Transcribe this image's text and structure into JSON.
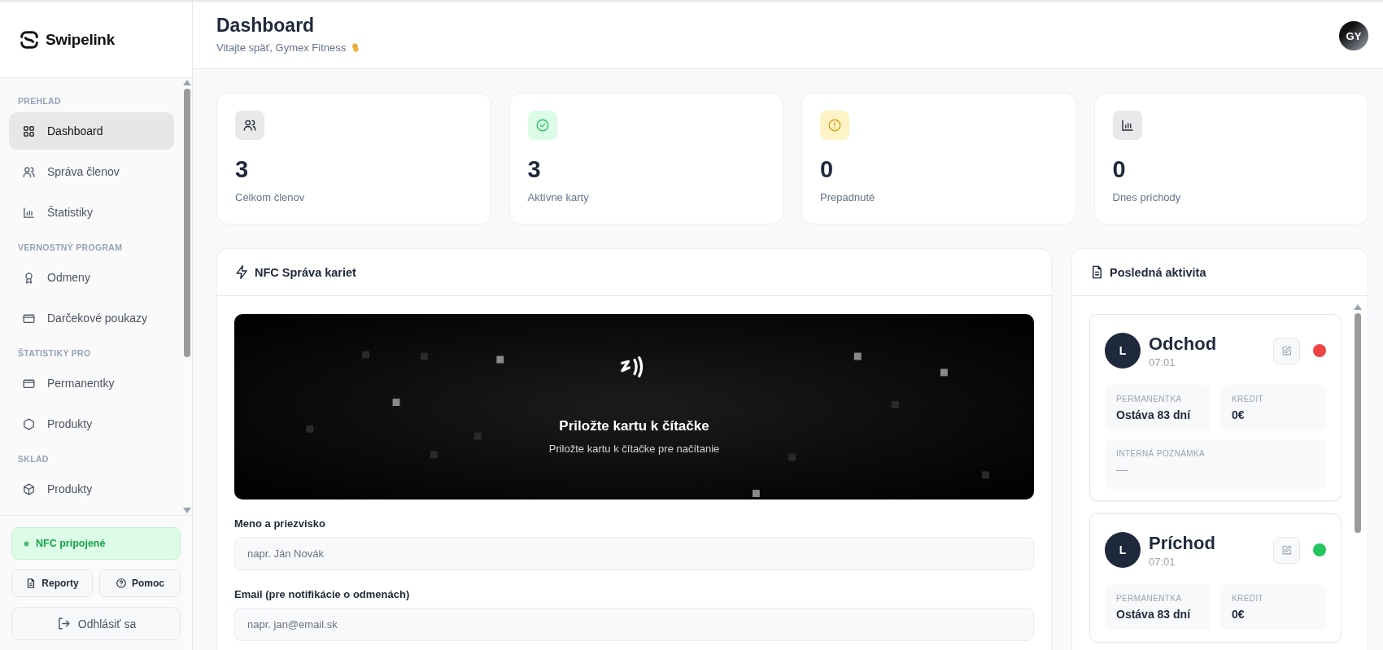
{
  "sidebar": {
    "logo": "Swipelink",
    "sections": [
      {
        "heading": "PREHĽAD",
        "items": [
          {
            "label": "Dashboard",
            "selected": true
          },
          {
            "label": "Správa členov",
            "selected": false
          },
          {
            "label": "Štatistiky",
            "selected": false
          }
        ]
      },
      {
        "heading": "VERNOSTNÝ PROGRAM",
        "items": [
          {
            "label": "Odmeny",
            "selected": false
          },
          {
            "label": "Darčekové poukazy",
            "selected": false
          }
        ]
      },
      {
        "heading": "ŠTATISTIKY PRO",
        "items": [
          {
            "label": "Permanentky",
            "selected": false
          },
          {
            "label": "Produkty",
            "selected": false
          }
        ]
      },
      {
        "heading": "SKLAD",
        "items": [
          {
            "label": "Produkty",
            "selected": false
          }
        ]
      }
    ],
    "nfc_status": {
      "label": "NFC pripojené",
      "connected": true
    },
    "buttons": [
      {
        "label": "Reporty"
      },
      {
        "label": "Pomoc"
      }
    ],
    "logout": "Odhlásiť sa"
  },
  "header": {
    "title": "Dashboard",
    "subtitle": "Vitajte späť, Gymex Fitness",
    "avatar": "GY"
  },
  "stats": [
    {
      "value": "3",
      "label": "Celkom členov"
    },
    {
      "value": "3",
      "label": "Aktívne karty"
    },
    {
      "value": "0",
      "label": "Prepadnuté"
    },
    {
      "value": "0",
      "label": "Dnes príchody"
    }
  ],
  "nfc_panel": {
    "title": "NFC Správa kariet",
    "reader": {
      "title": "Priložte kartu k čítačke",
      "subtitle": "Priložte kartu k čítačke pre načítanie"
    },
    "fields": [
      {
        "label": "Meno a priezvisko",
        "placeholder": "napr. Ján Novák"
      },
      {
        "label": "Email (pre notifikácie o odmenách)",
        "placeholder": "napr. jan@email.sk"
      }
    ]
  },
  "activity": {
    "title": "Posledná aktivita",
    "entries": [
      {
        "initial": "L",
        "type": "Odchod",
        "time": "07:01",
        "color": "#ef4444",
        "fields": [
          {
            "label": "PERMANENTKA",
            "value": "Ostáva 83 dní"
          },
          {
            "label": "KREDIT",
            "value": "0€"
          }
        ],
        "note": {
          "label": "INTERNÁ POZNÁMKA",
          "value": "—"
        }
      },
      {
        "initial": "L",
        "type": "Príchod",
        "time": "07:01",
        "color": "#22c55e",
        "fields": [
          {
            "label": "PERMANENTKA",
            "value": "Ostáva 83 dní"
          },
          {
            "label": "KREDIT",
            "value": "0€"
          }
        ]
      }
    ]
  }
}
